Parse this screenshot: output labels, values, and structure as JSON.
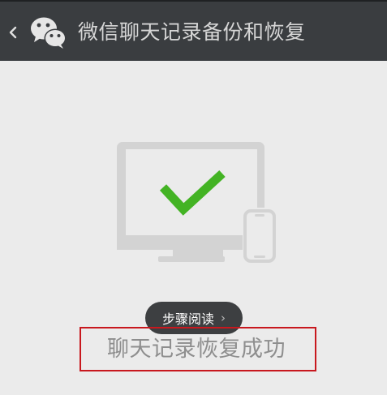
{
  "header": {
    "back_icon": "chevron-left-icon",
    "app_icon": "wechat-icon",
    "title": "微信聊天记录备份和恢复"
  },
  "illustration": {
    "icon": "monitor-phone-checkmark-icon",
    "check_color": "#43b324",
    "device_color": "#d3d3d3"
  },
  "step_button": {
    "label": "步骤阅读",
    "icon": "chevron-right-icon"
  },
  "status": {
    "message": "聊天记录恢复成功",
    "highlight_color": "#c8181e"
  },
  "colors": {
    "header_bg": "#3a3d40",
    "page_bg": "#ebebeb"
  }
}
